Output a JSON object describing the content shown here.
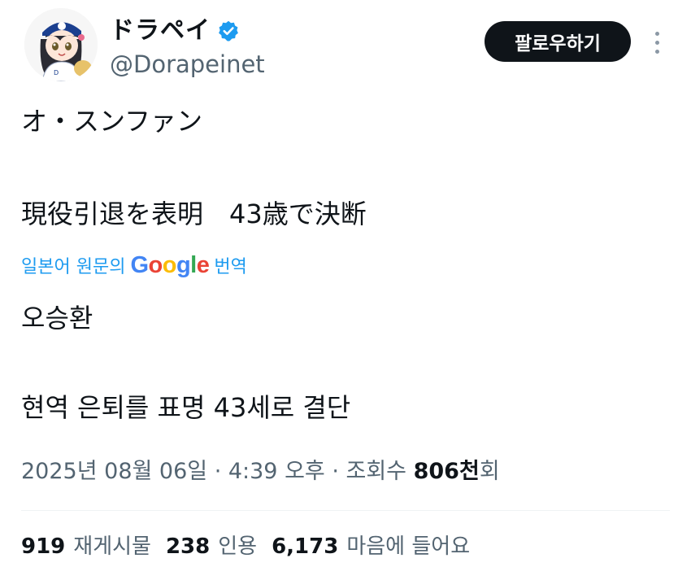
{
  "author": {
    "display_name": "ドラペイ",
    "handle": "@Dorapeinet",
    "avatar_icon": "anime-avatar-icon",
    "verified_icon": "verified-badge-icon",
    "verified_color": "#1d9bf0"
  },
  "actions": {
    "follow_label": "팔로우하기",
    "more_icon": "more-vertical-icon"
  },
  "tweet": {
    "original_lines": [
      "オ・スンファン",
      "現役引退を表明　43歳で決断"
    ],
    "translation_prefix": "일본어 원문의",
    "translation_logo": "Google",
    "translation_suffix": "번역",
    "translated_lines": [
      "오승환",
      "현역 은퇴를 표명 43세로 결단"
    ]
  },
  "meta": {
    "timestamp": "2025년 08월 06일 · 4:39 오후 · 조회수 ",
    "views_count": "806천",
    "views_suffix": "회"
  },
  "stats": {
    "reposts_count": "919",
    "reposts_label": "재게시물",
    "quotes_count": "238",
    "quotes_label": "인용",
    "likes_count": "6,173",
    "likes_label": "마음에 들어요"
  },
  "colors": {
    "link": "#1d9bf0",
    "secondary_text": "#536471",
    "primary_text": "#0f1419"
  }
}
